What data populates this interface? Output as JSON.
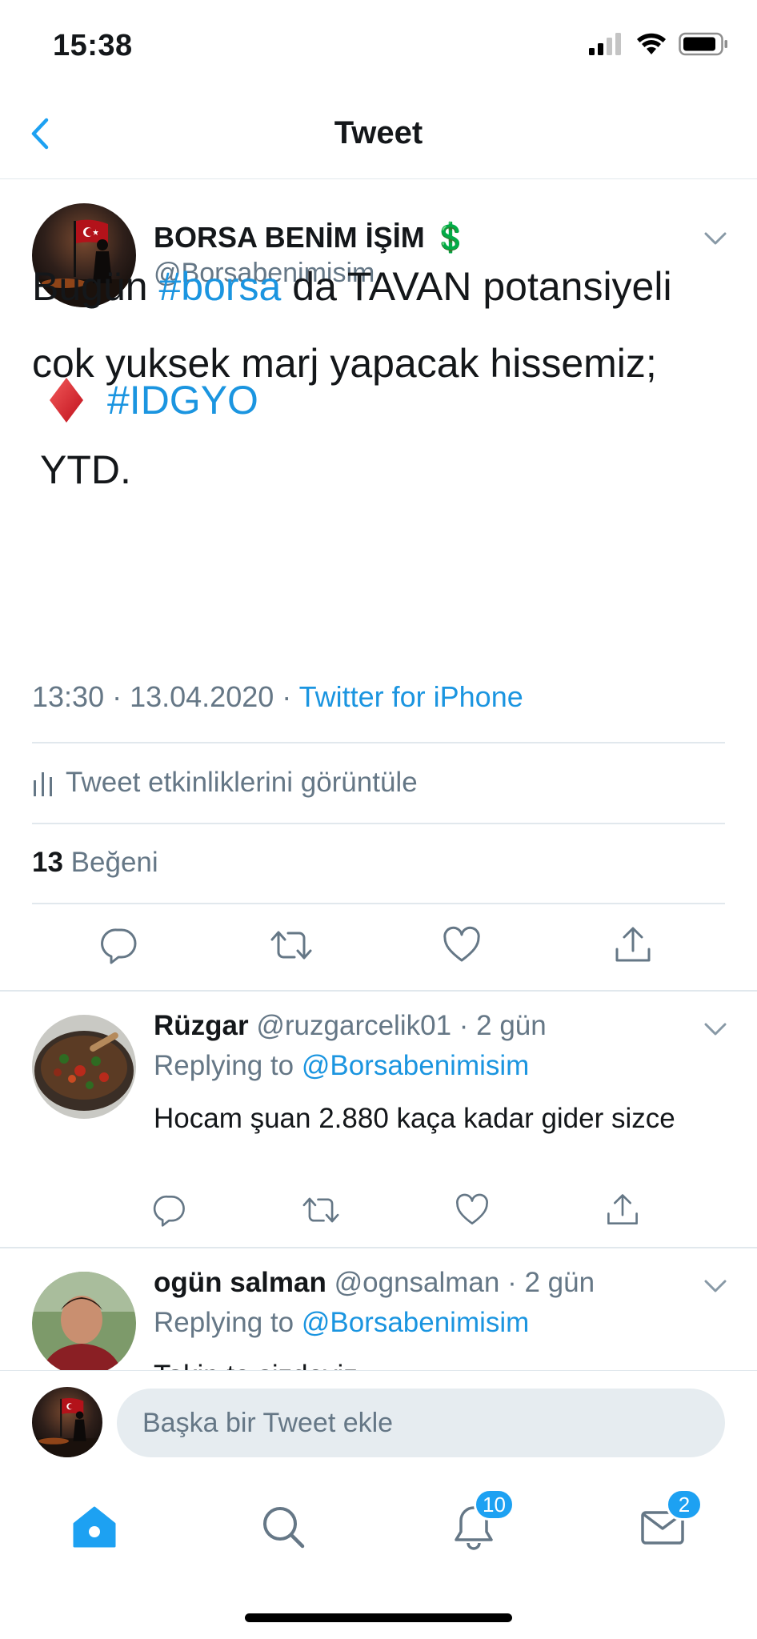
{
  "status": {
    "time": "15:38"
  },
  "nav": {
    "title": "Tweet"
  },
  "tweet": {
    "author_name": "BORSA BENİM İŞİM 💲",
    "author_handle": "@Borsabenimisim",
    "text_part1": "Bugün ",
    "hashtag1": "#borsa",
    "text_part2": " da TAVAN potansiyeli cok yuksek marj yapacak hissemiz;",
    "hashtag2": "#IDGYO",
    "text_part3": "YTD.",
    "time": "13:30 · 13.04.2020 · ",
    "source": "Twitter for iPhone",
    "activity_label": "Tweet etkinliklerini görüntüle",
    "likes_count": "13",
    "likes_label": "Beğeni"
  },
  "replies": [
    {
      "name": "Rüzgar",
      "meta": "@ruzgarcelik01 · 2 gün",
      "replying_label": "Replying to ",
      "replying_to": "@Borsabenimisim",
      "text": "Hocam şuan 2.880 kaça kadar gider sizce"
    },
    {
      "name": "ogün salman",
      "meta": "@ognsalman · 2 gün",
      "replying_label": "Replying to ",
      "replying_to": "@Borsabenimisim",
      "text": "Takip te sizdeyiz"
    }
  ],
  "compose": {
    "placeholder": "Başka bir Tweet ekle"
  },
  "tabbar": {
    "notifications_badge": "10",
    "messages_badge": "2"
  },
  "colors": {
    "accent": "#1da1f2",
    "link": "#1b95e0",
    "secondary": "#657786"
  }
}
